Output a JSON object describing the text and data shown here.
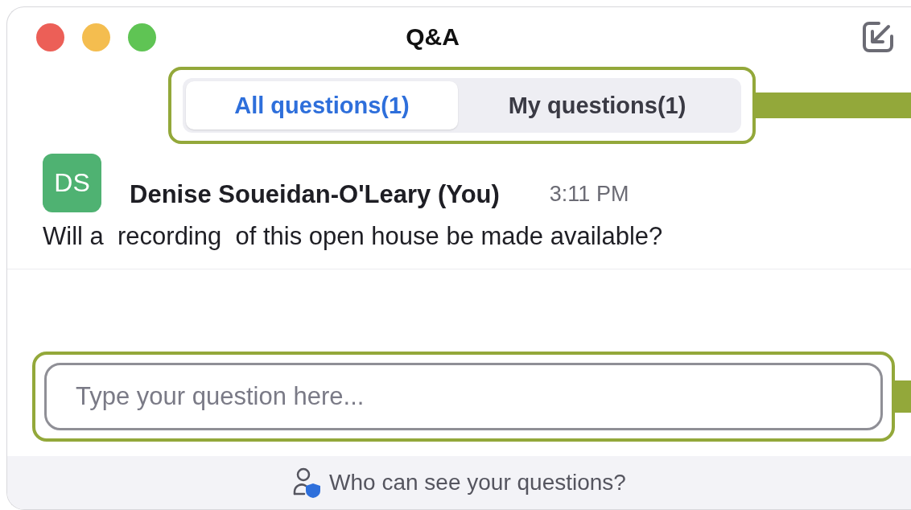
{
  "window": {
    "title": "Q&A"
  },
  "tabs": [
    {
      "label": "All questions(1)",
      "selected": true
    },
    {
      "label": "My questions(1)",
      "selected": false
    }
  ],
  "questions": [
    {
      "initials": "DS",
      "author": "Denise Soueidan-O'Leary (You)",
      "time": "3:11 PM",
      "text": "Will a  recording  of this open house be made available?"
    }
  ],
  "input": {
    "placeholder": "Type your question here..."
  },
  "footer": {
    "text": "Who can see your questions?"
  }
}
